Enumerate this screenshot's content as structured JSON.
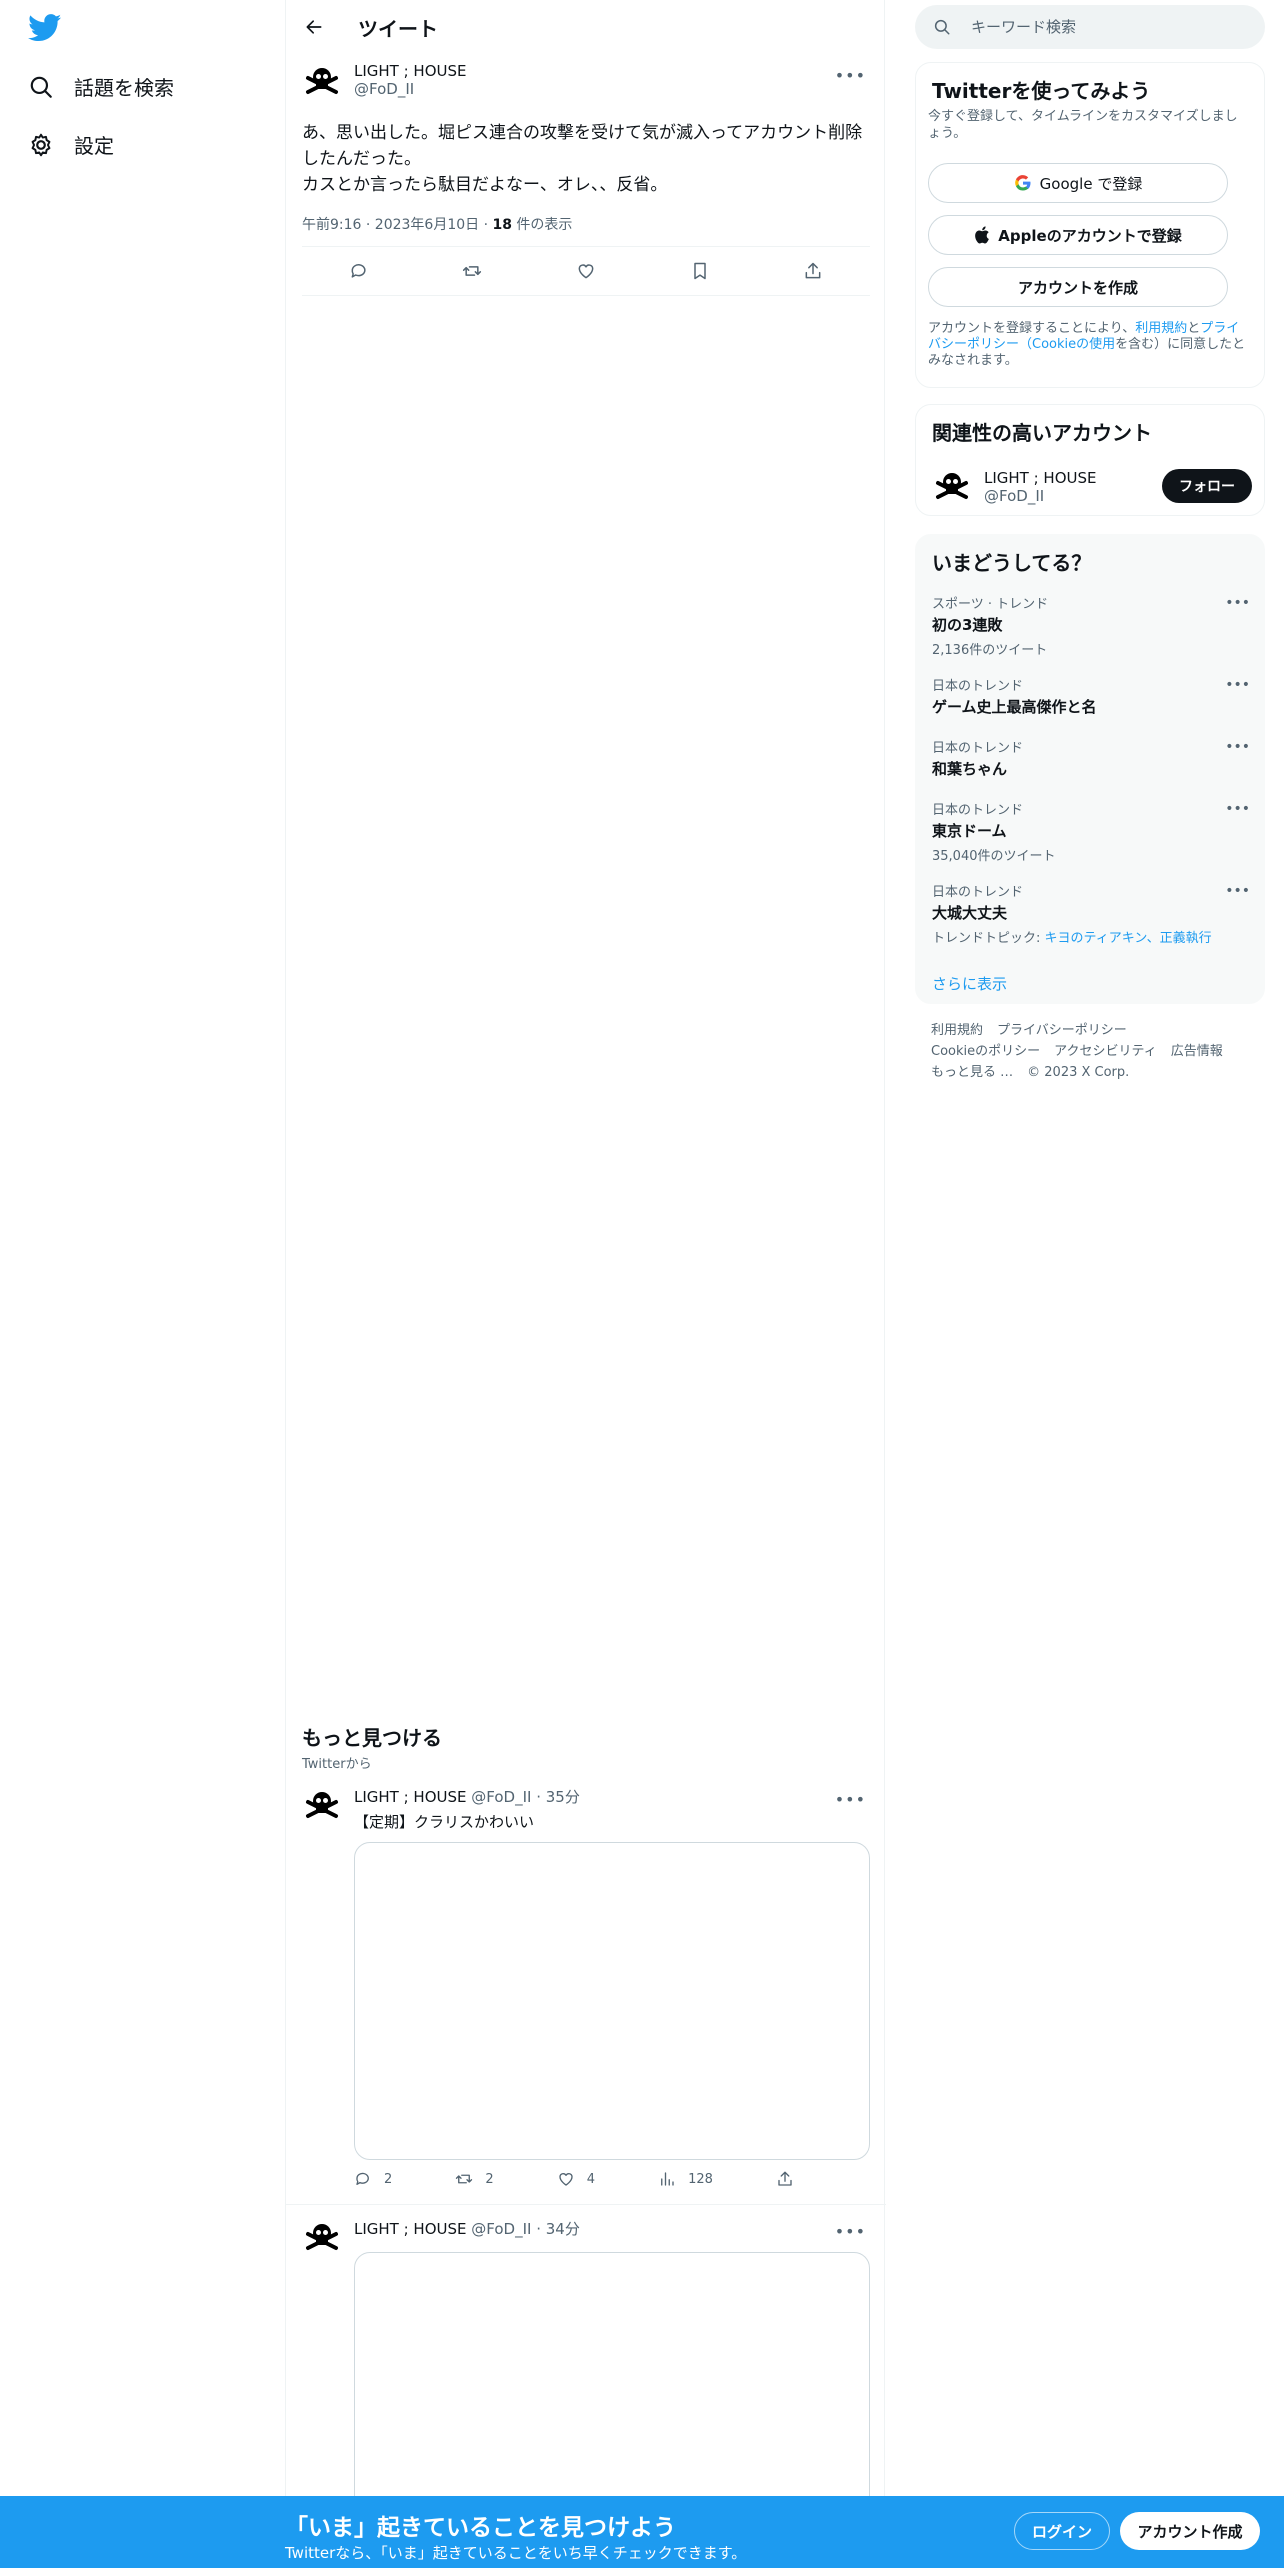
{
  "nav": {
    "explore_label": "話題を検索",
    "settings_label": "設定"
  },
  "header": {
    "title": "ツイート"
  },
  "tweet": {
    "name": "LIGHT ; HOUSE",
    "handle": "@FoD_II",
    "text": "あ、思い出した。堀ピス連合の攻撃を受けて気が滅入ってアカウント削除したんだった。\nカスとか言ったら駄目だよなー、オレ、、反省。",
    "time": "午前9:16 · 2023年6月10日 · ",
    "views_count": "18",
    "views_label": " 件の表示"
  },
  "discover": {
    "title": "もっと見つける",
    "sub": "Twitterから"
  },
  "feed": [
    {
      "name": "LIGHT ; HOUSE",
      "handle_time": "@FoD_II · 35分",
      "text": "【定期】クラリスかわいい",
      "replies": "2",
      "retweets": "2",
      "likes": "4",
      "views": "128"
    },
    {
      "name": "LIGHT ; HOUSE",
      "handle_time": "@FoD_II · 34分"
    }
  ],
  "search": {
    "placeholder": "キーワード検索"
  },
  "signup_card": {
    "title": "Twitterを使ってみよう",
    "sub": "今すぐ登録して、タイムラインをカスタマイズしましょう。",
    "google_btn": "Google で登録",
    "apple_btn": "Appleのアカウントで登録",
    "create_btn": "アカウントを作成",
    "terms_pre": "アカウントを登録することにより、",
    "terms_link1": "利用規約",
    "terms_mid": "と",
    "terms_link2": "プライバシーポリシー（Cookieの使用",
    "terms_post": "を含む）に同意したとみなされます。"
  },
  "relevant": {
    "title": "関連性の高いアカウント",
    "name": "LIGHT ; HOUSE",
    "handle": "@FoD_II",
    "follow_btn": "フォロー"
  },
  "trends": {
    "title": "いまどうしてる？",
    "items": [
      {
        "category": "スポーツ · トレンド",
        "title": "初の3連敗",
        "count": "2,136件のツイート"
      },
      {
        "category": "日本のトレンド",
        "title": "ゲーム史上最高傑作と名",
        "count": ""
      },
      {
        "category": "日本のトレンド",
        "title": "和葉ちゃん",
        "count": ""
      },
      {
        "category": "日本のトレンド",
        "title": "東京ドーム",
        "count": "35,040件のツイート"
      },
      {
        "category": "日本のトレンド",
        "title": "大城大丈夫",
        "count": ""
      }
    ],
    "topic_prefix": "トレンドトピック: ",
    "topic_links": "キヨのティアキン、正義執行",
    "show_more": "さらに表示"
  },
  "footer": {
    "links": [
      "利用規約",
      "プライバシーポリシー",
      "Cookieのポリシー",
      "アクセシビリティ",
      "広告情報",
      "もっと見る …",
      "© 2023 X Corp."
    ]
  },
  "bottom_bar": {
    "title": "「いま」起きていることを見つけよう",
    "sub": "Twitterなら、「いま」起きていることをいち早くチェックできます。",
    "login": "ログイン",
    "signup": "アカウント作成"
  },
  "colors": {
    "accent": "#1d9bf0",
    "text": "#0f1419",
    "secondary": "#536471"
  }
}
